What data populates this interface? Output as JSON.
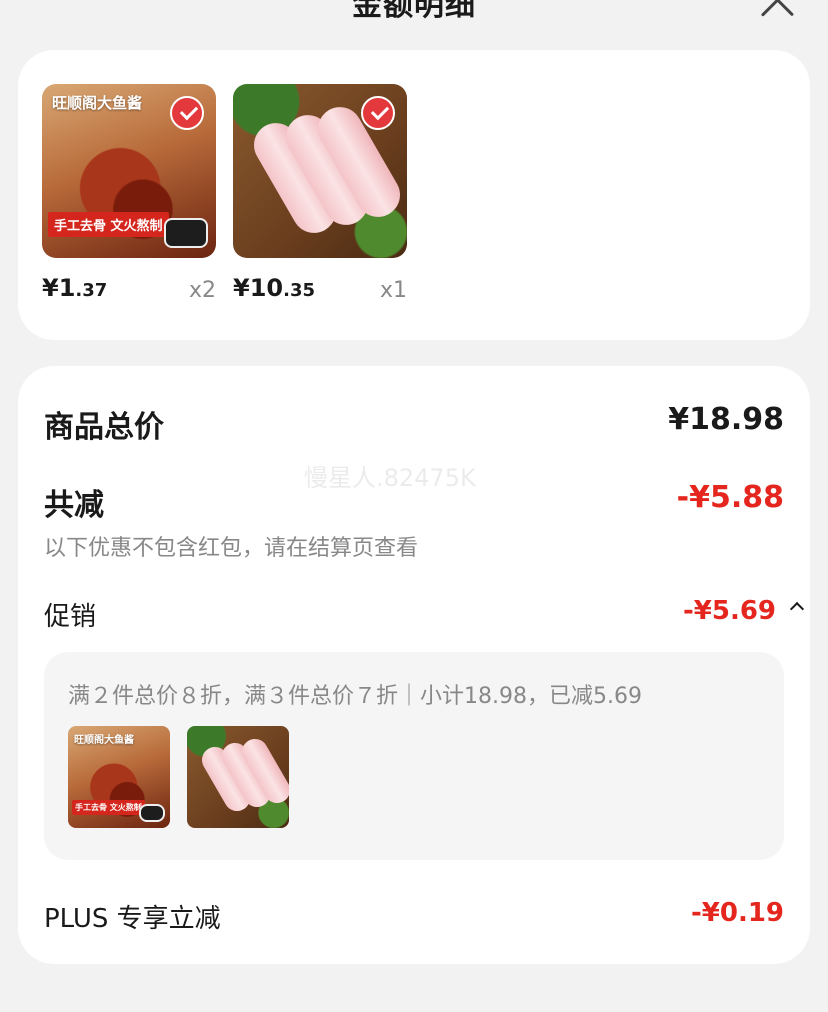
{
  "header": {
    "title": "金额明细"
  },
  "items": [
    {
      "brand": "旺顺阁大鱼酱",
      "banner": "手工去骨 文火熬制",
      "price_main": "¥1",
      "price_decimal": ".37",
      "qty": "x2",
      "selected": true
    },
    {
      "price_main": "¥10",
      "price_decimal": ".35",
      "qty": "x1",
      "selected": true
    }
  ],
  "detail": {
    "total_label": "商品总价",
    "total_value": "¥18.98",
    "reduce_label": "共减",
    "reduce_value": "-¥5.88",
    "hint": "以下优惠不包含红包，请在结算页查看",
    "promo_label": "促销",
    "promo_value": "-¥5.69",
    "promo_rule": "满２件总价８折，满３件总价７折｜小计18.98，已减5.69",
    "plus_label": "PLUS 专享立减",
    "plus_value": "-¥0.19",
    "watermark": "慢星人.82475K"
  },
  "colors": {
    "accent_red": "#e4261f",
    "card_bg": "#ffffff",
    "page_bg": "#f2f2f2"
  }
}
